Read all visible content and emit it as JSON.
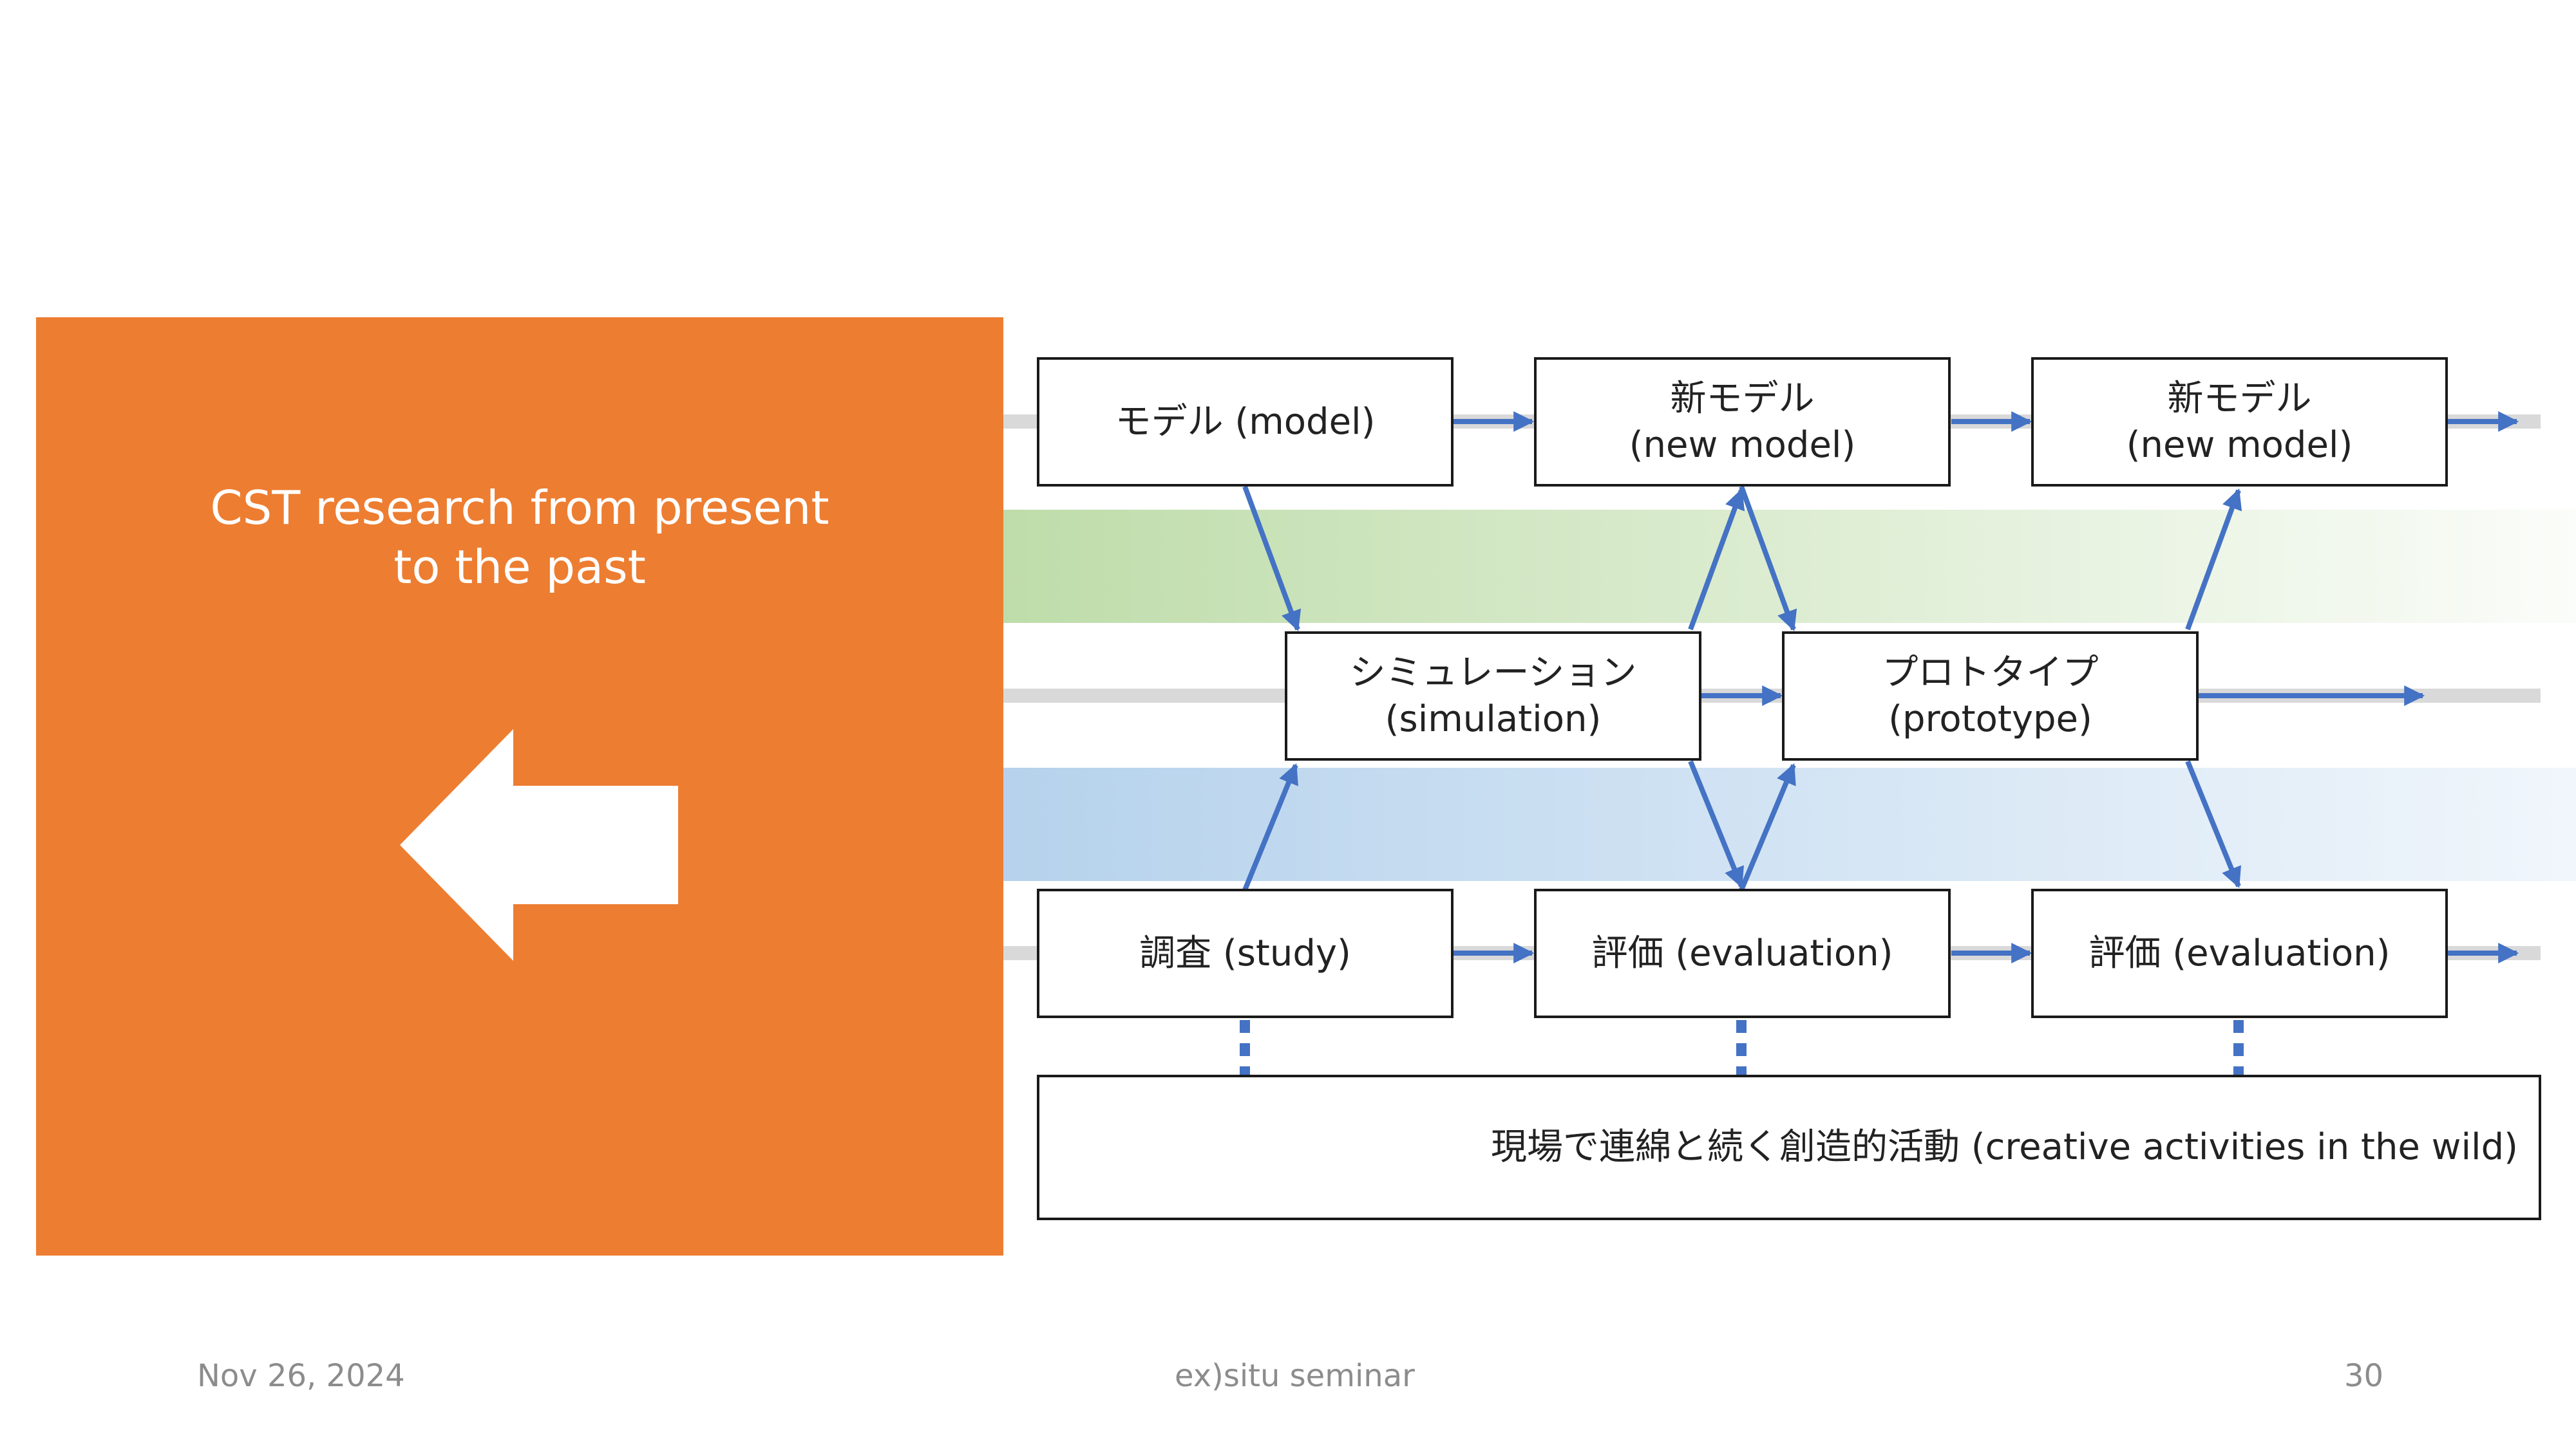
{
  "panel": {
    "title": "CST research from present\nto the past",
    "color": "#ED7D31",
    "arrow_icon": "left-arrow-icon"
  },
  "diagram": {
    "row_top": {
      "box1": "モデル (model)",
      "box2": "新モデル\n(new model)",
      "box3": "新モデル\n(new model)"
    },
    "row_mid": {
      "box1": "シミュレーション\n(simulation)",
      "box2": "プロトタイプ\n(prototype)"
    },
    "row_bottom": {
      "box1": "調査 (study)",
      "box2": "評価 (evaluation)",
      "box3": "評価 (evaluation)"
    },
    "wild": "現場で連綿と続く創造的活動 (creative activities in the wild)",
    "colors": {
      "arrow": "#4472C4",
      "green_band": "#A9D18E",
      "blue_band": "#9DC3E6",
      "track": "#D9D9D9"
    }
  },
  "footer": {
    "date": "Nov 26, 2024",
    "center": "ex)situ seminar",
    "page": "30"
  }
}
